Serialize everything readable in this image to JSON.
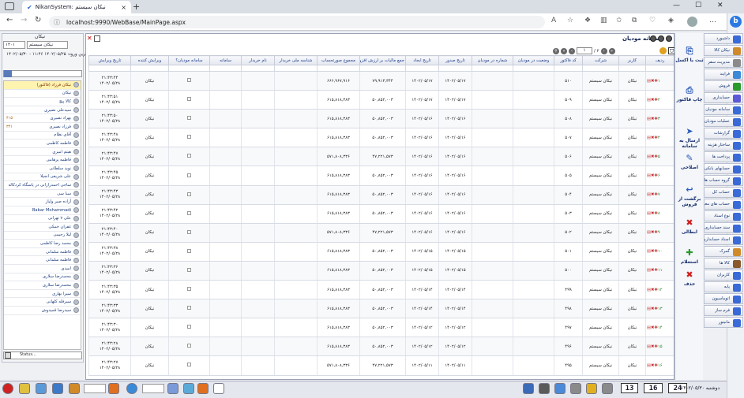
{
  "browser": {
    "tab_title": "NikanSystem: نیکان سیستم",
    "url": "localhost:9990/WebBase/MainPage.aspx",
    "new_tab": "+",
    "close_tab": "×",
    "win_min": "—",
    "win_max": "☐",
    "win_close": "✕",
    "back": "←",
    "forward": "→",
    "reload": "↻",
    "info_icon": "ⓘ",
    "bing": "b"
  },
  "left_panel": {
    "title": "نیکان",
    "company_select": "نیکان سیستم",
    "year_select": "۱۴۰۱",
    "date_text": "۱۴۰۲/۰۵/۳۰ - ۱۱:۴۶ آخرین ورود: ۱۴۰۲/۰۵/۲۵",
    "items": [
      {
        "label": "نیکان فرزاد (فاکتور)",
        "count": ""
      },
      {
        "label": "نیکان",
        "count": ""
      },
      {
        "label": "کالا پیچ",
        "count": ""
      },
      {
        "label": "سیدعلی نصیری",
        "count": ""
      },
      {
        "label": "بهزاد نصیری",
        "count": "۴۱۵"
      },
      {
        "label": "فرزاد نصیری",
        "count": "۳۴۱"
      },
      {
        "label": "آقای نظام",
        "count": ""
      },
      {
        "label": "فاطمه کاظمی",
        "count": ""
      },
      {
        "label": "هیثم امیری",
        "count": ""
      },
      {
        "label": "فاطمه پرهامی",
        "count": ""
      },
      {
        "label": "نوید سلطانی",
        "count": ""
      },
      {
        "label": "علی شریفی انجیلا",
        "count": ""
      },
      {
        "label": "ساجی احمدرازانی در پاسگاه کردکاله",
        "count": ""
      },
      {
        "label": "سیا سی",
        "count": ""
      },
      {
        "label": "آزاده صبر ولیاز",
        "count": ""
      },
      {
        "label": "Babar Mohammadi",
        "count": ""
      },
      {
        "label": "علی ۷ تهرانی",
        "count": ""
      },
      {
        "label": "غفران خمکی",
        "count": ""
      },
      {
        "label": "لیلا رحیمی",
        "count": ""
      },
      {
        "label": "محمد رضا کاظمی",
        "count": ""
      },
      {
        "label": "فاطمه سلمانی",
        "count": ""
      },
      {
        "label": "فاطمه سلمانی",
        "count": ""
      },
      {
        "label": "امیدی",
        "count": ""
      },
      {
        "label": "محمدرضا سلاری",
        "count": ""
      },
      {
        "label": "محمدرضا سلاری",
        "count": ""
      },
      {
        "label": "سیرا بهاری",
        "count": ""
      },
      {
        "label": "سیرقله کلهانی",
        "count": ""
      },
      {
        "label": "سیدرضا قمیدوش",
        "count": ""
      }
    ],
    "bottom_status": "Status..."
  },
  "main": {
    "title": "سامانه مودیان",
    "page_input": "۱",
    "page_total": "/ ۲",
    "columns": [
      "ردیف",
      "کاربر",
      "شرکت",
      "کد فاکتور",
      "وضعیت در مودیان",
      "شماره در مودیان",
      "تاریخ صدور",
      "تاریخ ایجاد",
      "جمع مالیات بر ارزش افزوده",
      "مجموع صورتحساب",
      "شناسه ملی خریدار",
      "نام خریدار",
      "سامانه",
      "سامانه مودیان؟",
      "ویرایش کننده",
      "تاریخ ویرایش"
    ],
    "rows": [
      {
        "user": "نیکان",
        "company": "نیکان سیستم",
        "code": "۵۱۰",
        "issue": "۱۴۰۲/۰۵/۱۷",
        "created": "۱۴۰۲/۰۵/۱۷",
        "vat": "۷۹,۹۱۳,۳۴۴",
        "total": "۶۶۶,۹۶۷,۹۱۶",
        "editor": "نیکان",
        "time": "۲۱:۴۳:۴۴",
        "date": "۱۴۰۲/۰۵/۲۸"
      },
      {
        "user": "نیکان",
        "company": "نیکان سیستم",
        "code": "۵۰۹",
        "issue": "۱۴۰۲/۰۵/۱۷",
        "created": "۱۴۰۲/۰۵/۱۷",
        "vat": "۵۰,۸۵۲,۰۰۳",
        "total": "۶۱۵,۸۱۸,۳۸۳",
        "editor": "نیکان",
        "time": "۲۱:۴۳:۵۱",
        "date": "۱۴۰۲/۰۵/۲۸"
      },
      {
        "user": "نیکان",
        "company": "نیکان سیستم",
        "code": "۵۰۸",
        "issue": "۱۴۰۲/۰۵/۱۶",
        "created": "۱۴۰۲/۰۵/۱۶",
        "vat": "۵۰,۸۵۲,۰۰۳",
        "total": "۶۱۵,۸۱۸,۳۸۳",
        "editor": "نیکان",
        "time": "۲۱:۴۳:۵۰",
        "date": "۱۴۰۲/۰۵/۲۸"
      },
      {
        "user": "نیکان",
        "company": "نیکان سیستم",
        "code": "۵۰۷",
        "issue": "۱۴۰۲/۰۵/۱۶",
        "created": "۱۴۰۲/۰۵/۱۶",
        "vat": "۵۰,۸۵۲,۰۰۳",
        "total": "۶۱۵,۸۱۸,۳۸۳",
        "editor": "نیکان",
        "time": "۲۱:۴۳:۴۸",
        "date": "۱۴۰۲/۰۵/۲۸"
      },
      {
        "user": "نیکان",
        "company": "نیکان سیستم",
        "code": "۵۰۶",
        "issue": "۱۴۰۲/۰۵/۱۶",
        "created": "۱۴۰۲/۰۵/۱۶",
        "vat": "۴۷,۲۲۱,۵۷۳",
        "total": "۵۷۱,۸۰۸,۳۳۶",
        "editor": "نیکان",
        "time": "۲۱:۴۳:۴۷",
        "date": "۱۴۰۲/۰۵/۲۸"
      },
      {
        "user": "نیکان",
        "company": "نیکان سیستم",
        "code": "۵۰۵",
        "issue": "۱۴۰۲/۰۵/۱۶",
        "created": "۱۴۰۲/۰۵/۱۶",
        "vat": "۵۰,۸۵۲,۰۰۳",
        "total": "۶۱۵,۸۱۸,۳۸۳",
        "editor": "نیکان",
        "time": "۲۱:۴۳:۴۵",
        "date": "۱۴۰۲/۰۵/۲۸"
      },
      {
        "user": "نیکان",
        "company": "نیکان سیستم",
        "code": "۵۰۴",
        "issue": "۱۴۰۲/۰۵/۱۶",
        "created": "۱۴۰۲/۰۵/۱۶",
        "vat": "۵۰,۸۵۲,۰۰۳",
        "total": "۶۱۵,۸۱۸,۳۸۳",
        "editor": "نیکان",
        "time": "۲۱:۴۳:۴۳",
        "date": "۱۴۰۲/۰۵/۲۸"
      },
      {
        "user": "نیکان",
        "company": "نیکان سیستم",
        "code": "۵۰۳",
        "issue": "۱۴۰۲/۰۵/۱۶",
        "created": "۱۴۰۲/۰۵/۱۶",
        "vat": "۵۰,۸۵۲,۰۰۳",
        "total": "۶۱۵,۸۱۸,۳۸۳",
        "editor": "نیکان",
        "time": "۲۱:۴۳:۴۲",
        "date": "۱۴۰۲/۰۵/۲۸"
      },
      {
        "user": "نیکان",
        "company": "نیکان سیستم",
        "code": "۵۰۲",
        "issue": "۱۴۰۲/۰۵/۱۶",
        "created": "۱۴۰۲/۰۵/۱۶",
        "vat": "۴۷,۲۲۱,۵۷۳",
        "total": "۵۷۱,۸۰۸,۳۳۶",
        "editor": "نیکان",
        "time": "۲۱:۴۳:۴۰",
        "date": "۱۴۰۲/۰۵/۲۸"
      },
      {
        "user": "نیکان",
        "company": "نیکان سیستم",
        "code": "۵۰۱",
        "issue": "۱۴۰۲/۰۵/۱۵",
        "created": "۱۴۰۲/۰۵/۱۵",
        "vat": "۵۰,۸۵۲,۰۰۳",
        "total": "۶۱۵,۸۱۸,۳۸۳",
        "editor": "نیکان",
        "time": "۲۱:۴۳:۳۸",
        "date": "۱۴۰۲/۰۵/۲۸"
      },
      {
        "user": "نیکان",
        "company": "نیکان سیستم",
        "code": "۵۰۰",
        "issue": "۱۴۰۲/۰۵/۱۵",
        "created": "۱۴۰۲/۰۵/۱۵",
        "vat": "۵۰,۸۵۲,۰۰۳",
        "total": "۶۱۵,۸۱۸,۳۸۳",
        "editor": "نیکان",
        "time": "۲۱:۴۳:۳۶",
        "date": "۱۴۰۲/۰۵/۲۸"
      },
      {
        "user": "نیکان",
        "company": "نیکان سیستم",
        "code": "۴۹۹",
        "issue": "۱۴۰۲/۰۵/۱۴",
        "created": "۱۴۰۲/۰۵/۱۴",
        "vat": "۵۰,۸۵۲,۰۰۳",
        "total": "۶۱۵,۸۱۸,۳۸۳",
        "editor": "نیکان",
        "time": "۲۱:۴۳:۳۵",
        "date": "۱۴۰۲/۰۵/۲۸"
      },
      {
        "user": "نیکان",
        "company": "نیکان سیستم",
        "code": "۴۹۸",
        "issue": "۱۴۰۲/۰۵/۱۴",
        "created": "۱۴۰۲/۰۵/۱۴",
        "vat": "۵۰,۸۵۲,۰۰۳",
        "total": "۶۱۵,۸۱۸,۳۸۳",
        "editor": "نیکان",
        "time": "۲۱:۴۳:۳۳",
        "date": "۱۴۰۲/۰۵/۲۸"
      },
      {
        "user": "نیکان",
        "company": "نیکان سیستم",
        "code": "۴۹۷",
        "issue": "۱۴۰۲/۰۵/۱۲",
        "created": "۱۴۰۲/۰۵/۱۲",
        "vat": "۵۰,۸۵۲,۰۰۳",
        "total": "۶۱۵,۸۱۸,۳۸۳",
        "editor": "نیکان",
        "time": "۲۱:۴۳:۳۰",
        "date": "۱۴۰۲/۰۵/۲۸"
      },
      {
        "user": "نیکان",
        "company": "نیکان سیستم",
        "code": "۴۹۶",
        "issue": "۱۴۰۲/۰۵/۱۲",
        "created": "۱۴۰۲/۰۵/۱۲",
        "vat": "۵۰,۸۵۲,۰۰۳",
        "total": "۶۱۵,۸۱۸,۳۸۳",
        "editor": "نیکان",
        "time": "۲۱:۴۳:۲۸",
        "date": "۱۴۰۲/۰۵/۲۸"
      },
      {
        "user": "نیکان",
        "company": "نیکان سیستم",
        "code": "۴۹۵",
        "issue": "۱۴۰۲/۰۵/۱۱",
        "created": "۱۴۰۲/۰۵/۱۱",
        "vat": "۴۷,۲۲۱,۵۷۳",
        "total": "۵۷۱,۸۰۸,۳۳۶",
        "editor": "نیکان",
        "time": "۲۱:۴۳:۲۷",
        "date": "۱۴۰۲/۰۵/۲۸"
      }
    ],
    "row_numbers": [
      "۱",
      "۲",
      "۳",
      "۴",
      "۵",
      "۶",
      "۷",
      "۸",
      "۹",
      "۱۰",
      "۱۱",
      "۱۲",
      "۱۳",
      "۱۴",
      "۱۵",
      "۱۶"
    ]
  },
  "actions": [
    {
      "label": "ثبت با اکسل",
      "icon": "excel-icon",
      "glyph": "⎘"
    },
    {
      "label": "چاپ فاکتور",
      "icon": "print-icon",
      "glyph": "⎙"
    },
    {
      "label": "ارسال به سامانه",
      "icon": "send-icon",
      "glyph": "➤"
    },
    {
      "label": "اصلاحی",
      "icon": "edit-icon",
      "glyph": "✎"
    },
    {
      "label": "برگشت از فروش",
      "icon": "return-icon",
      "glyph": "↩"
    },
    {
      "label": "ابطالی",
      "icon": "cancel-icon",
      "glyph": "✖"
    },
    {
      "label": "استعلام",
      "icon": "inquiry-icon",
      "glyph": "✚"
    },
    {
      "label": "حذف",
      "icon": "delete-icon",
      "glyph": "✖"
    }
  ],
  "menu": [
    {
      "label": "داشبورد",
      "color": "#3a6ad8"
    },
    {
      "label": "نیکان کالا",
      "color": "#d08a2a"
    },
    {
      "label": "مدیریت سفر",
      "color": "#8a8a8a"
    },
    {
      "label": "فرایند",
      "color": "#3a8ad8"
    },
    {
      "label": "فروش",
      "color": "#2a9a2a"
    },
    {
      "label": "حسابداری",
      "color": "#5a5ad8"
    },
    {
      "label": "سامانه مودیان",
      "color": "#3a6ad8"
    },
    {
      "label": "عملیات مودیان",
      "color": "#3a6ad8"
    },
    {
      "label": "گزارشات",
      "color": "#3a6ad8"
    },
    {
      "label": "ساختار هزینه",
      "color": "#3a6ad8"
    },
    {
      "label": "پرداخت ها",
      "color": "#3a6ad8"
    },
    {
      "label": "حسابهای بانکی",
      "color": "#3a6ad8"
    },
    {
      "label": "گروه حساب ها",
      "color": "#3a6ad8"
    },
    {
      "label": "حساب کل",
      "color": "#3a6ad8"
    },
    {
      "label": "حساب های معین",
      "color": "#3a6ad8"
    },
    {
      "label": "نوع اسناد",
      "color": "#3a6ad8"
    },
    {
      "label": "سند حسابداری",
      "color": "#3a6ad8"
    },
    {
      "label": "اسناد حسابداری",
      "color": "#3a6ad8"
    },
    {
      "label": "گمرک",
      "color": "#d08a2a"
    },
    {
      "label": "کالا ها",
      "color": "#8a5a2a"
    },
    {
      "label": "کاربران",
      "color": "#3a6ad8"
    },
    {
      "label": "پایه",
      "color": "#3a6ad8"
    },
    {
      "label": "اتوماسیون",
      "color": "#3a6ad8"
    },
    {
      "label": "فرم ساز",
      "color": "#3a6ad8"
    },
    {
      "label": "مانیتور",
      "color": "#3a6ad8"
    }
  ],
  "taskbar": {
    "date": "۱۴۰۲/۰۵/۳۰ دوشنبه",
    "numbers": [
      "24",
      "16",
      "13"
    ]
  }
}
